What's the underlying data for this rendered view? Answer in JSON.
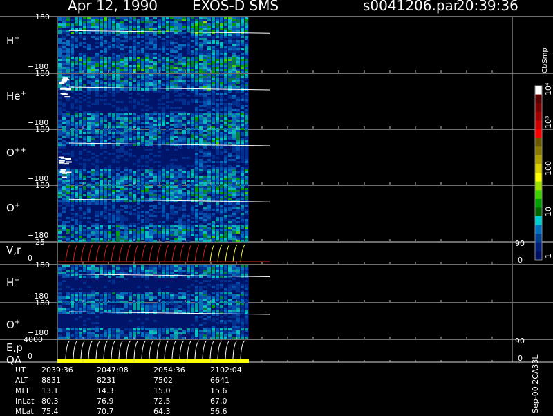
{
  "header": {
    "date": "Apr 12, 1990",
    "mission": "EXOS-D SMS",
    "file": "s0041206.par",
    "time": "20:39:36"
  },
  "panels": [
    {
      "label": "H",
      "sup": "+",
      "top_tick": "180",
      "bottom_tick": "−180"
    },
    {
      "label": "He",
      "sup": "+",
      "top_tick": "180",
      "bottom_tick": "−180"
    },
    {
      "label": "O",
      "sup": "++",
      "top_tick": "180",
      "bottom_tick": "−180"
    },
    {
      "label": "O",
      "sup": "+",
      "top_tick": "180",
      "bottom_tick": "−180"
    },
    {
      "label": "V,r",
      "sup": "",
      "top_tick": "25",
      "bottom_tick": "0",
      "right_top": "90",
      "right_bottom": "0"
    },
    {
      "label": "H",
      "sup": "+",
      "top_tick": "180",
      "bottom_tick": "−180"
    },
    {
      "label": "O",
      "sup": "+",
      "top_tick": "180",
      "bottom_tick": "−180"
    },
    {
      "label": "E,p",
      "sup": "",
      "top_tick": "4000",
      "bottom_tick": "0",
      "right_top": "90",
      "right_bottom": "0"
    }
  ],
  "qa_label": "QA",
  "colorbar": {
    "title": "Ct/Smp",
    "labels": [
      "10⁴",
      "10³",
      "100",
      "10",
      "1"
    ],
    "colors": [
      "#ffffff",
      "#5a0000",
      "#7a0000",
      "#a00000",
      "#d00000",
      "#ff0000",
      "#6a5a00",
      "#8a7a00",
      "#b0a000",
      "#d8d000",
      "#ffff00",
      "#a0e000",
      "#40d000",
      "#00a000",
      "#006600",
      "#00d0d0",
      "#0070c0",
      "#004090",
      "#00207a",
      "#001060"
    ]
  },
  "footer": {
    "row_labels": [
      "UT",
      "ALT",
      "MLT",
      "InLat",
      "MLat"
    ],
    "columns": [
      [
        "2039:36",
        "8831",
        "13.1",
        "80.3",
        "75.4"
      ],
      [
        "2047:08",
        "8231",
        "14.3",
        "76.9",
        "70.7"
      ],
      [
        "2054:36",
        "7502",
        "15.0",
        "72.5",
        "64.3"
      ],
      [
        "2102:04",
        "6641",
        "15.6",
        "67.0",
        "56.6"
      ]
    ],
    "side_text": "Sep-00  2CA33L"
  },
  "chart_data": {
    "type": "heatmap",
    "title": "Apr 12, 1990   EXOS-D SMS",
    "x_ticks_ut": [
      "2039:36",
      "2047:08",
      "2054:36",
      "2102:04"
    ],
    "pitch_angle_range": [
      -180,
      180
    ],
    "V_r_range": [
      0,
      25
    ],
    "E_p_range": [
      0,
      4000
    ],
    "right_axis_range": [
      0,
      90
    ],
    "colorbar_range_ct_per_smp": [
      1,
      10000
    ],
    "colorbar_scale": "log",
    "grid": false
  }
}
